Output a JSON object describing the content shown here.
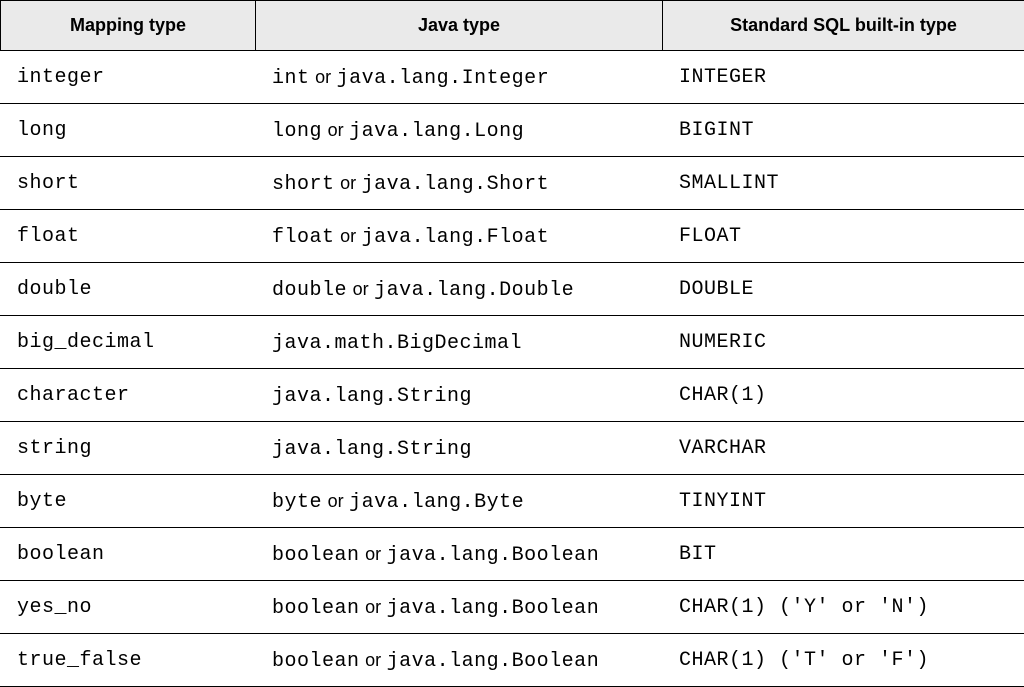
{
  "table": {
    "headers": {
      "mapping": "Mapping type",
      "java": "Java type",
      "sql": "Standard SQL built-in type"
    },
    "or_word": "or",
    "rows": [
      {
        "mapping": "integer",
        "java_a": "int",
        "java_b": "java.lang.Integer",
        "sql": "INTEGER"
      },
      {
        "mapping": "long",
        "java_a": "long",
        "java_b": "java.lang.Long",
        "sql": "BIGINT"
      },
      {
        "mapping": "short",
        "java_a": "short",
        "java_b": "java.lang.Short",
        "sql": "SMALLINT"
      },
      {
        "mapping": "float",
        "java_a": "float",
        "java_b": "java.lang.Float",
        "sql": "FLOAT"
      },
      {
        "mapping": "double",
        "java_a": "double",
        "java_b": "java.lang.Double",
        "sql": "DOUBLE"
      },
      {
        "mapping": "big_decimal",
        "java_a": "java.math.BigDecimal",
        "java_b": "",
        "sql": "NUMERIC"
      },
      {
        "mapping": "character",
        "java_a": "java.lang.String",
        "java_b": "",
        "sql": "CHAR(1)"
      },
      {
        "mapping": "string",
        "java_a": "java.lang.String",
        "java_b": "",
        "sql": "VARCHAR"
      },
      {
        "mapping": "byte",
        "java_a": "byte",
        "java_b": "java.lang.Byte",
        "sql": "TINYINT"
      },
      {
        "mapping": "boolean",
        "java_a": "boolean",
        "java_b": "java.lang.Boolean",
        "sql": "BIT"
      },
      {
        "mapping": "yes_no",
        "java_a": "boolean",
        "java_b": "java.lang.Boolean",
        "sql": "CHAR(1) ('Y' or 'N')"
      },
      {
        "mapping": "true_false",
        "java_a": "boolean",
        "java_b": "java.lang.Boolean",
        "sql": "CHAR(1) ('T' or 'F')"
      }
    ]
  }
}
